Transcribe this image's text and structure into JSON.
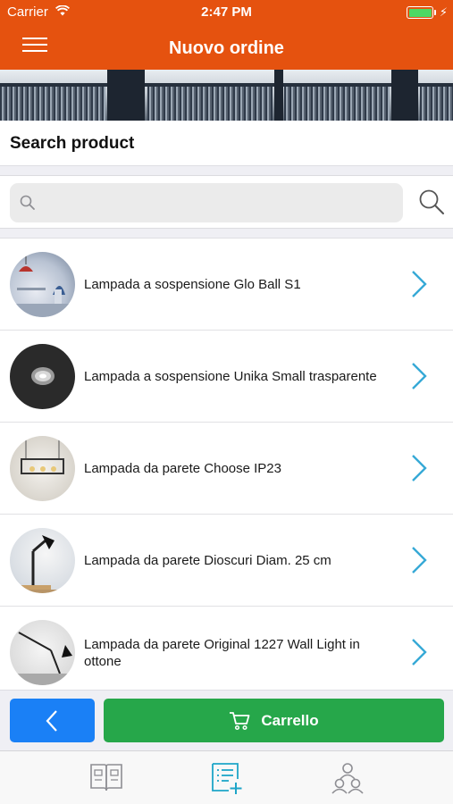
{
  "status_bar": {
    "carrier": "Carrier",
    "time": "2:47 PM",
    "battery_level": 1.0
  },
  "nav": {
    "title": "Nuovo ordine",
    "menu_icon": "hamburger-menu-icon"
  },
  "search": {
    "section_title": "Search product",
    "value": "",
    "placeholder": "",
    "field_icon": "search-icon",
    "button_icon": "search-icon"
  },
  "products": [
    {
      "name": "Lampada a sospensione Glo Ball S1",
      "icon": "chevron-right-icon"
    },
    {
      "name": "Lampada a sospensione Unika Small trasparente",
      "icon": "chevron-right-icon"
    },
    {
      "name": "Lampada da parete Choose IP23",
      "icon": "chevron-right-icon"
    },
    {
      "name": "Lampada da parete Dioscuri Diam. 25 cm",
      "icon": "chevron-right-icon"
    },
    {
      "name": "Lampada da parete Original 1227 Wall Light in ottone",
      "icon": "chevron-right-icon"
    }
  ],
  "actions": {
    "back_icon": "chevron-left-icon",
    "cart_label": "Carrello",
    "cart_icon": "cart-icon"
  },
  "tabs": [
    {
      "icon": "catalog-book-icon",
      "active": false
    },
    {
      "icon": "new-order-list-icon",
      "active": true
    },
    {
      "icon": "customers-icon",
      "active": false
    }
  ],
  "colors": {
    "header": "#e5520f",
    "back_button": "#1a80f6",
    "cart_button": "#26a74a",
    "chevron": "#36a9d6",
    "tab_active": "#1ea5c8",
    "tab_inactive": "#8e8e93"
  }
}
